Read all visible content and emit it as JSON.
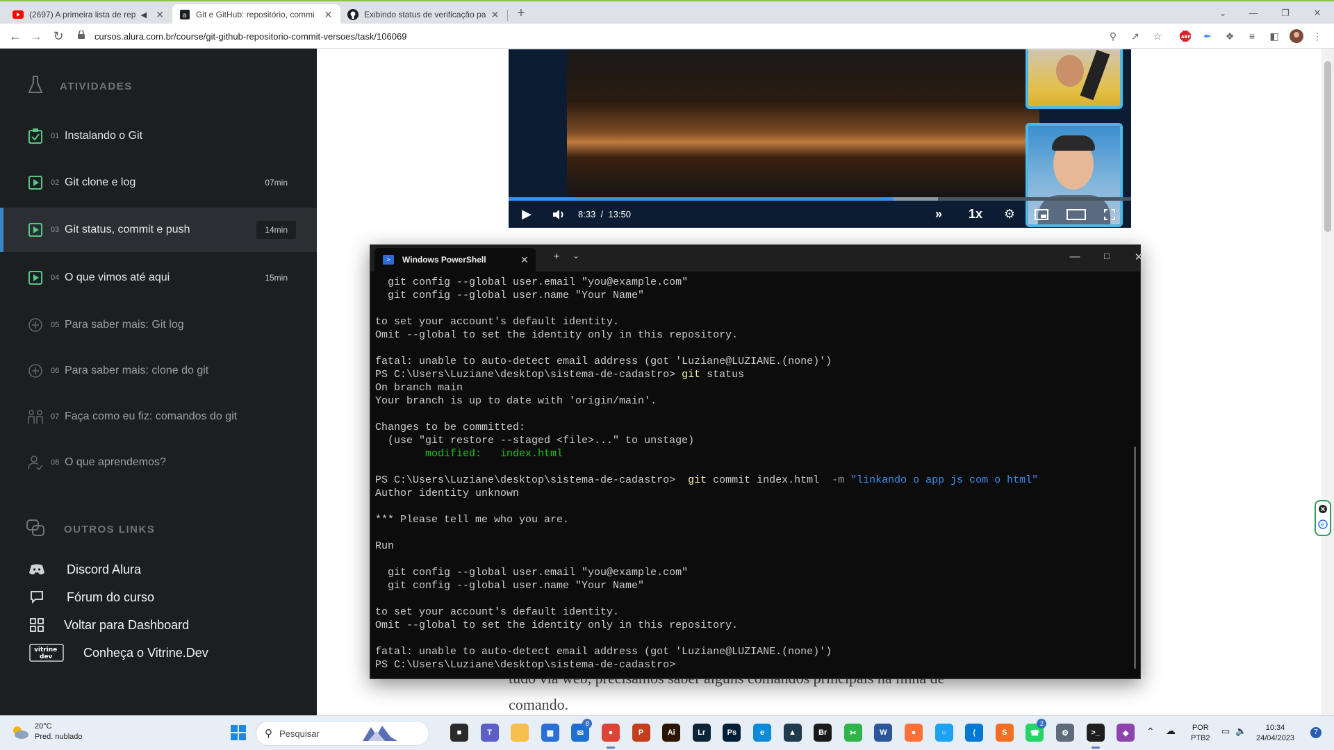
{
  "browser": {
    "tabs": [
      {
        "title": "(2697) A primeira lista de rep",
        "icon": "youtube-icon",
        "active": false
      },
      {
        "title": "Git e GitHub: repositório, commi",
        "icon": "alura-icon",
        "active": true
      },
      {
        "title": "Exibindo status de verificação pa",
        "icon": "github-icon",
        "active": false
      }
    ],
    "new_tab_label": "+",
    "url": "cursos.alura.com.br/course/git-github-repositorio-commit-versoes/task/106069"
  },
  "sidebar": {
    "activities_heading": "ATIVIDADES",
    "activities": [
      {
        "num": "01",
        "label": "Instalando o Git",
        "duration": "",
        "icon": "task-check-icon",
        "current": false,
        "muted": false
      },
      {
        "num": "02",
        "label": "Git clone e log",
        "duration": "07min",
        "icon": "video-play-icon",
        "current": false,
        "muted": false
      },
      {
        "num": "03",
        "label": "Git status, commit e push",
        "duration": "14min",
        "icon": "video-play-icon",
        "current": true,
        "muted": false
      },
      {
        "num": "04",
        "label": "O que vimos até aqui",
        "duration": "15min",
        "icon": "video-play-icon",
        "current": false,
        "muted": false
      },
      {
        "num": "05",
        "label": "Para saber mais: Git log",
        "duration": "",
        "icon": "plus-circle-icon",
        "current": false,
        "muted": true
      },
      {
        "num": "06",
        "label": "Para saber mais: clone do git",
        "duration": "",
        "icon": "plus-circle-icon",
        "current": false,
        "muted": true
      },
      {
        "num": "07",
        "label": "Faça como eu fiz: comandos do git",
        "duration": "",
        "icon": "people-icon",
        "current": false,
        "muted": true
      },
      {
        "num": "08",
        "label": "O que aprendemos?",
        "duration": "",
        "icon": "person-check-icon",
        "current": false,
        "muted": true
      }
    ],
    "links_heading": "OUTROS LINKS",
    "links": [
      {
        "label": "Discord Alura",
        "icon": "discord-icon"
      },
      {
        "label": "Fórum do curso",
        "icon": "forum-icon"
      },
      {
        "label": "Voltar para Dashboard",
        "icon": "dashboard-icon"
      },
      {
        "label": "Conheça o Vitrine.Dev",
        "icon": "vitrine-dev-icon"
      }
    ],
    "vitrine_logo_text": "vitrine dev"
  },
  "video": {
    "current_time": "8:33",
    "time_separator": "/",
    "duration": "13:50",
    "played_fraction": 0.618,
    "buffered_fraction": 0.69,
    "speed": "1x"
  },
  "article": {
    "partial_line": "tudo via web, precisamos saber alguns comandos principais na linha de",
    "line2": "comando."
  },
  "powershell": {
    "tab_title": "Windows PowerShell",
    "lines": [
      [
        {
          "t": "  git config --global user.email \"you@example.com\"",
          "c": ""
        }
      ],
      [
        {
          "t": "  git config --global user.name \"Your Name\"",
          "c": ""
        }
      ],
      [
        {
          "t": "",
          "c": ""
        }
      ],
      [
        {
          "t": "to set your account's default identity.",
          "c": ""
        }
      ],
      [
        {
          "t": "Omit --global to set the identity only in this repository.",
          "c": ""
        }
      ],
      [
        {
          "t": "",
          "c": ""
        }
      ],
      [
        {
          "t": "fatal: unable to auto-detect email address (got 'Luziane@LUZIANE.(none)')",
          "c": ""
        }
      ],
      [
        {
          "t": "PS C:\\Users\\Luziane\\desktop\\sistema-de-cadastro> ",
          "c": ""
        },
        {
          "t": "git",
          "c": "y"
        },
        {
          "t": " status",
          "c": ""
        }
      ],
      [
        {
          "t": "On branch main",
          "c": ""
        }
      ],
      [
        {
          "t": "Your branch is up to date with 'origin/main'.",
          "c": ""
        }
      ],
      [
        {
          "t": "",
          "c": ""
        }
      ],
      [
        {
          "t": "Changes to be committed:",
          "c": ""
        }
      ],
      [
        {
          "t": "  (use \"git restore --staged <file>...\" to unstage)",
          "c": ""
        }
      ],
      [
        {
          "t": "        modified:   index.html",
          "c": "g"
        }
      ],
      [
        {
          "t": "",
          "c": ""
        }
      ],
      [
        {
          "t": "PS C:\\Users\\Luziane\\desktop\\sistema-de-cadastro>  ",
          "c": ""
        },
        {
          "t": "git",
          "c": "y"
        },
        {
          "t": " commit index.html  ",
          "c": ""
        },
        {
          "t": "-m",
          "c": "d"
        },
        {
          "t": " \"linkando o app js com o html\"",
          "c": "b"
        }
      ],
      [
        {
          "t": "Author identity unknown",
          "c": ""
        }
      ],
      [
        {
          "t": "",
          "c": ""
        }
      ],
      [
        {
          "t": "*** Please tell me who you are.",
          "c": ""
        }
      ],
      [
        {
          "t": "",
          "c": ""
        }
      ],
      [
        {
          "t": "Run",
          "c": ""
        }
      ],
      [
        {
          "t": "",
          "c": ""
        }
      ],
      [
        {
          "t": "  git config --global user.email \"you@example.com\"",
          "c": ""
        }
      ],
      [
        {
          "t": "  git config --global user.name \"Your Name\"",
          "c": ""
        }
      ],
      [
        {
          "t": "",
          "c": ""
        }
      ],
      [
        {
          "t": "to set your account's default identity.",
          "c": ""
        }
      ],
      [
        {
          "t": "Omit --global to set the identity only in this repository.",
          "c": ""
        }
      ],
      [
        {
          "t": "",
          "c": ""
        }
      ],
      [
        {
          "t": "fatal: unable to auto-detect email address (got 'Luziane@LUZIANE.(none)')",
          "c": ""
        }
      ],
      [
        {
          "t": "PS C:\\Users\\Luziane\\desktop\\sistema-de-cadastro> ",
          "c": ""
        }
      ]
    ]
  },
  "taskbar": {
    "weather_temp": "20°C",
    "weather_desc": "Pred. nublado",
    "search_placeholder": "Pesquisar",
    "apps": [
      "file-explorer-icon",
      "teams-icon",
      "folder-icon",
      "store-icon",
      "mail-icon",
      "chrome-icon",
      "powerpoint-icon",
      "illustrator-icon",
      "lightroom-icon",
      "photoshop-icon",
      "edge-icon",
      "unknown-app-icon",
      "bridge-icon",
      "unknown-green-app-icon",
      "word-icon",
      "firefox-icon",
      "unknown-round-app-icon",
      "vscode-icon",
      "sublime-icon",
      "whatsapp-icon",
      "settings-icon",
      "terminal-icon",
      "unknown-colorful-app-icon"
    ],
    "mail_badge": "8",
    "whatsapp_badge": "2",
    "language_top": "POR",
    "language_bottom": "PTB2",
    "time": "10:34",
    "date": "24/04/2023",
    "notification_count": "7"
  },
  "colors": {
    "sidebar_bg": "#1c1f21",
    "accent_green": "#8bc34a",
    "accent_blue": "#3a86c9",
    "terminal_bg": "#0c0c0c"
  }
}
